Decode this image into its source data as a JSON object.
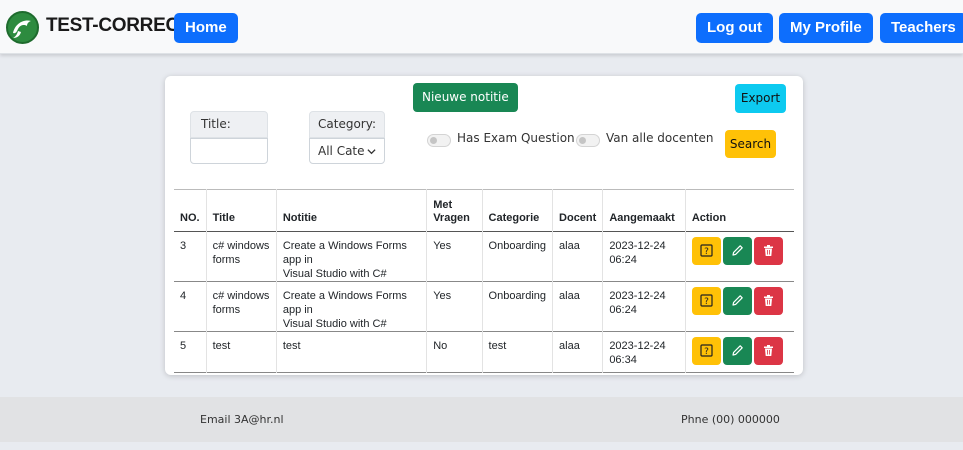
{
  "navbar": {
    "brand": "TEST-CORRECT",
    "home_label": "Home",
    "logout_label": "Log out",
    "profile_label": "My Profile",
    "teachers_label": "Teachers"
  },
  "filters": {
    "new_note_label": "Nieuwe notitie",
    "export_label": "Export",
    "title_label": "Title:",
    "title_value": "",
    "category_label": "Category:",
    "category_value": "All Categ",
    "toggle_exam_label": "Has Exam Question",
    "toggle_all_teachers_label": "Van alle docenten",
    "search_label": "Search"
  },
  "table": {
    "headers": {
      "no": "NO.",
      "title": "Title",
      "notitie": "Notitie",
      "met_vragen_line1": "Met",
      "met_vragen_line2": "Vragen",
      "categorie": "Categorie",
      "docent": "Docent",
      "aangemaakt": "Aangemaakt",
      "action": "Action"
    },
    "rows": [
      {
        "no": "3",
        "title_l1": "c# windows",
        "title_l2": "forms",
        "notitie_l1": "Create a Windows Forms app in",
        "notitie_l2": "Visual Studio with C#",
        "met_vragen": "Yes",
        "categorie": "Onboarding",
        "docent": "alaa",
        "date": "2023-12-24",
        "time": "06:24"
      },
      {
        "no": "4",
        "title_l1": "c# windows",
        "title_l2": "forms",
        "notitie_l1": "Create a Windows Forms app in",
        "notitie_l2": "Visual Studio with C#",
        "met_vragen": "Yes",
        "categorie": "Onboarding",
        "docent": "alaa",
        "date": "2023-12-24",
        "time": "06:24"
      },
      {
        "no": "5",
        "title_l1": "test",
        "title_l2": "",
        "notitie_l1": "test",
        "notitie_l2": "",
        "met_vragen": "No",
        "categorie": "test",
        "docent": "alaa",
        "date": "2023-12-24",
        "time": "06:34"
      }
    ]
  },
  "footer": {
    "email": "Email 3A@hr.nl",
    "phone": "Phne (00) 000000"
  },
  "colors": {
    "primary": "#0d6efd",
    "success": "#198754",
    "warning": "#ffc107",
    "danger": "#dc3545",
    "info": "#0dcaf0"
  },
  "icons": {
    "logo": "dolphin-logo-icon",
    "question": "question-square-icon",
    "edit": "pencil-icon",
    "delete": "trash-icon",
    "dropdown": "chevron-down-icon"
  }
}
